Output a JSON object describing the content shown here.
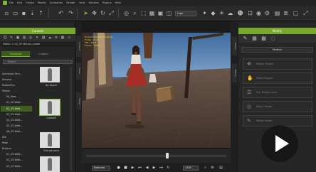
{
  "menu": [
    "File",
    "Edit",
    "Create",
    "Modify",
    "Animation",
    "Render",
    "View",
    "Window",
    "Plugins",
    "Help"
  ],
  "toolbar": {
    "quality": "High",
    "icons": [
      "new-file-icon",
      "open-folder-icon",
      "save-icon",
      "import-icon",
      "undo-icon",
      "redo-icon",
      "select-icon",
      "move-icon",
      "rotate-icon",
      "scale-icon",
      "camera-icon",
      "search-icon",
      "frame-icon",
      "grid-icon",
      "render-icon",
      "light-icon",
      "cube-icon",
      "sun-icon",
      "cloud-icon",
      "user-icon",
      "settings-icon",
      "fullscreen-icon"
    ]
  },
  "left_panel": {
    "title": "Content",
    "breadcrumb": "Motion > 02_G5 Motion_model",
    "tab_template": "Template",
    "tab_custom": "Custom",
    "search_placeholder": "Search",
    "tree": [
      "Animation Tem...",
      "Persona",
      "MotionPlus",
      "Motion",
      "00_Pose",
      "01_G5 Walk...",
      "02_G5 Walk...",
      "03_G5 Walk...",
      "04_G5 Walk...",
      "05_G5 Walk...",
      "06_G5 Walk...",
      "Idle",
      "Male",
      "Perform",
      "01_G5 Walk...",
      "02_G5 Walk...",
      "03_G5 Walk..."
    ],
    "selected_tree_index": 6,
    "thumbs": [
      "Ap dance",
      "Catwalk",
      "Change pace",
      ""
    ]
  },
  "side_tabs_left": [
    "Content",
    "Scene",
    "Visual"
  ],
  "side_tabs_right": [
    "Modify",
    "Motion"
  ],
  "viewport": {
    "info": [
      "Picked(ReadyWorkspace)",
      "Frame (1/1)",
      "FPS: 60.0",
      "Faces: 12546"
    ],
    "sky_color": "#4f77a8",
    "ground_color": "#5d4b40"
  },
  "timeline": {
    "mode": "Realtime",
    "frame": "1338",
    "position_fraction": 0.58
  },
  "right_panel": {
    "title": "Modify",
    "section": "Motion",
    "buttons": [
      "Motion Puppet",
      "Direct Puppet",
      "Edit Motion Layer",
      "Reach Target",
      "Motion Editor"
    ]
  }
}
